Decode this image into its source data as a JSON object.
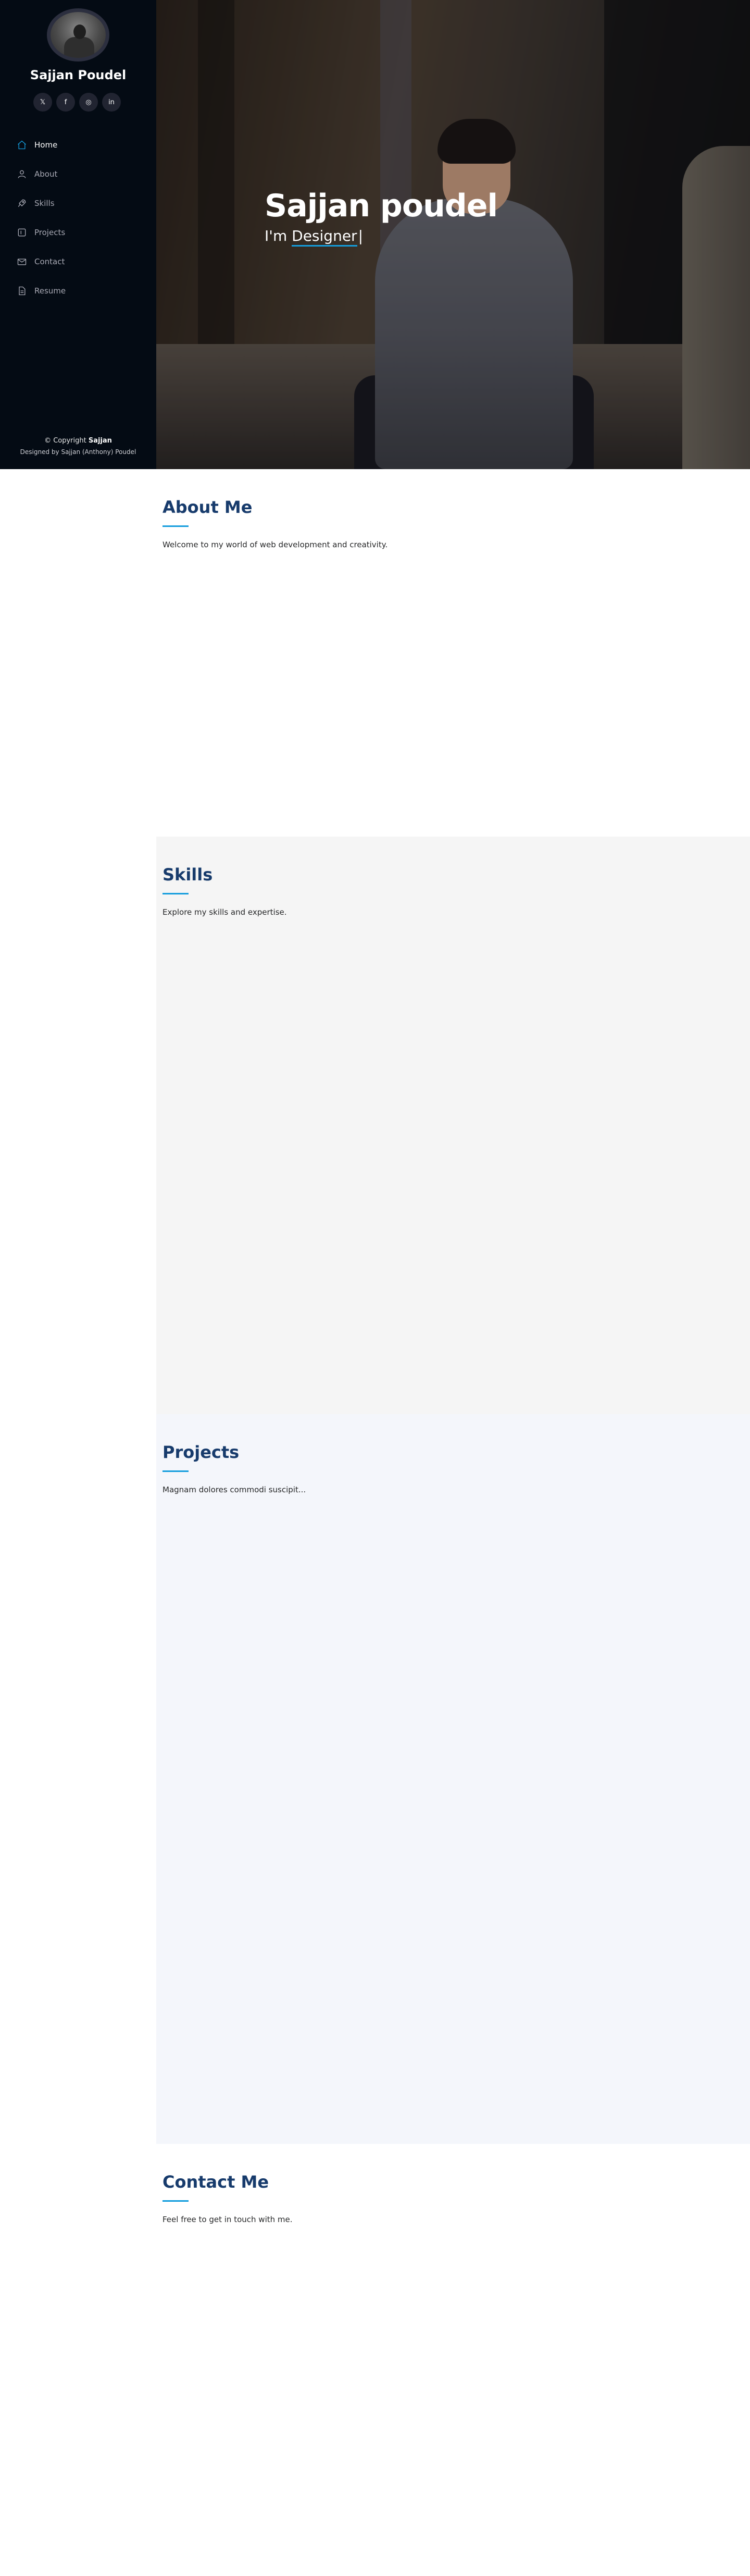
{
  "profile": {
    "name": "Sajjan Poudel"
  },
  "social": [
    {
      "icon": "twitter-icon",
      "glyph": "𝕏"
    },
    {
      "icon": "facebook-icon",
      "glyph": "f"
    },
    {
      "icon": "instagram-icon",
      "glyph": "◎"
    },
    {
      "icon": "linkedin-icon",
      "glyph": "in"
    }
  ],
  "nav": [
    {
      "label": "Home",
      "icon": "home-icon",
      "active": true
    },
    {
      "label": "About",
      "icon": "person-icon",
      "active": false
    },
    {
      "label": "Skills",
      "icon": "rocket-icon",
      "active": false
    },
    {
      "label": "Projects",
      "icon": "project-icon",
      "active": false
    },
    {
      "label": "Contact",
      "icon": "envelope-icon",
      "active": false
    },
    {
      "label": "Resume",
      "icon": "file-icon",
      "active": false
    }
  ],
  "footer": {
    "copyright_prefix": "© Copyright ",
    "copyright_name": "Sajjan",
    "designed_by": "Designed by Sajjan (Anthony) Poudel"
  },
  "hero": {
    "title": "Sajjan poudel",
    "sub_prefix": "I'm ",
    "typed": "Designer",
    "cursor": "|"
  },
  "sections": {
    "about": {
      "title": "About Me",
      "text": "Welcome to my world of web development and creativity."
    },
    "skills": {
      "title": "Skills",
      "text": "Explore my skills and expertise."
    },
    "projects": {
      "title": "Projects",
      "text": "Magnam dolores commodi suscipit..."
    },
    "contact": {
      "title": "Contact Me",
      "text": "Feel free to get in touch with me."
    }
  },
  "colors": {
    "sidebar_bg": "#040b14",
    "accent": "#149ddd",
    "heading": "#173b6c"
  }
}
